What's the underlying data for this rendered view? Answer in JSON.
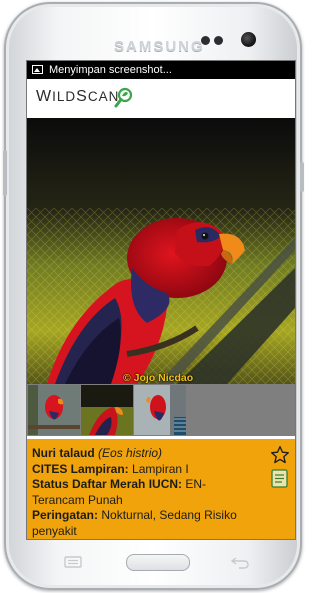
{
  "device": {
    "brand": "SAMSUNG"
  },
  "statusbar": {
    "notification_icon": "image-icon",
    "text": "Menyimpan screenshot..."
  },
  "app": {
    "logo_text": "WildScan",
    "logo_icon": "magnifier-leaf-icon"
  },
  "photo": {
    "credit": "© Jojo Nicdao",
    "thumbnail_count": 3
  },
  "species": {
    "common_name": "Nuri talaud",
    "scientific_name": "(Eos histrio)",
    "cites_label": "CITES Lampiran:",
    "cites_value": "Lampiran I",
    "iucn_label": "Status Daftar Merah IUCN:",
    "iucn_value": "EN- Terancam Punah",
    "warning_label": "Peringatan:",
    "warning_value": "Nokturnal, Sedang Risiko penyakit"
  },
  "actions": {
    "favorite_icon": "star-outline-icon",
    "notes_icon": "notes-icon"
  },
  "colors": {
    "info_panel": "#f0a30a",
    "credit_text": "#f2c21b",
    "logo_accent": "#3aa64a"
  }
}
